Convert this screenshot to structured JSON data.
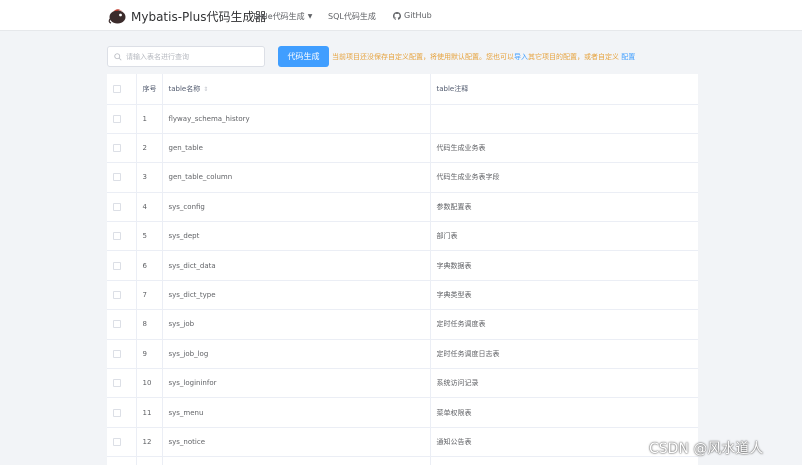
{
  "navbar": {
    "brand": "Mybatis-Plus代码生成器",
    "items": [
      {
        "label": "Table代码生成"
      },
      {
        "label": "SQL代码生成"
      },
      {
        "label": "GitHub"
      }
    ]
  },
  "toolbar": {
    "search_placeholder": "请输入表名进行查询",
    "generate_label": "代码生成",
    "notice_prefix": "当前项目还没保存自定义配置，将使用默认配置。您也可以",
    "import_link": "导入",
    "notice_middle": "其它项目的配置，或者自定义",
    "config_link": "配置"
  },
  "table": {
    "headers": {
      "index": "序号",
      "name": "table名称",
      "comment": "table注释"
    },
    "rows": [
      {
        "index": "1",
        "name": "flyway_schema_history",
        "comment": ""
      },
      {
        "index": "2",
        "name": "gen_table",
        "comment": "代码生成业务表"
      },
      {
        "index": "3",
        "name": "gen_table_column",
        "comment": "代码生成业务表字段"
      },
      {
        "index": "4",
        "name": "sys_config",
        "comment": "参数配置表"
      },
      {
        "index": "5",
        "name": "sys_dept",
        "comment": "部门表"
      },
      {
        "index": "6",
        "name": "sys_dict_data",
        "comment": "字典数据表"
      },
      {
        "index": "7",
        "name": "sys_dict_type",
        "comment": "字典类型表"
      },
      {
        "index": "8",
        "name": "sys_job",
        "comment": "定时任务调度表"
      },
      {
        "index": "9",
        "name": "sys_job_log",
        "comment": "定时任务调度日志表"
      },
      {
        "index": "10",
        "name": "sys_logininfor",
        "comment": "系统访问记录"
      },
      {
        "index": "11",
        "name": "sys_menu",
        "comment": "菜单权限表"
      },
      {
        "index": "12",
        "name": "sys_notice",
        "comment": "通知公告表"
      },
      {
        "index": "",
        "name": "",
        "comment": ""
      }
    ]
  },
  "watermark": "CSDN @风水道人",
  "colors": {
    "primary": "#409eff",
    "warning": "#e6a23c",
    "background": "#f2f4f7"
  }
}
